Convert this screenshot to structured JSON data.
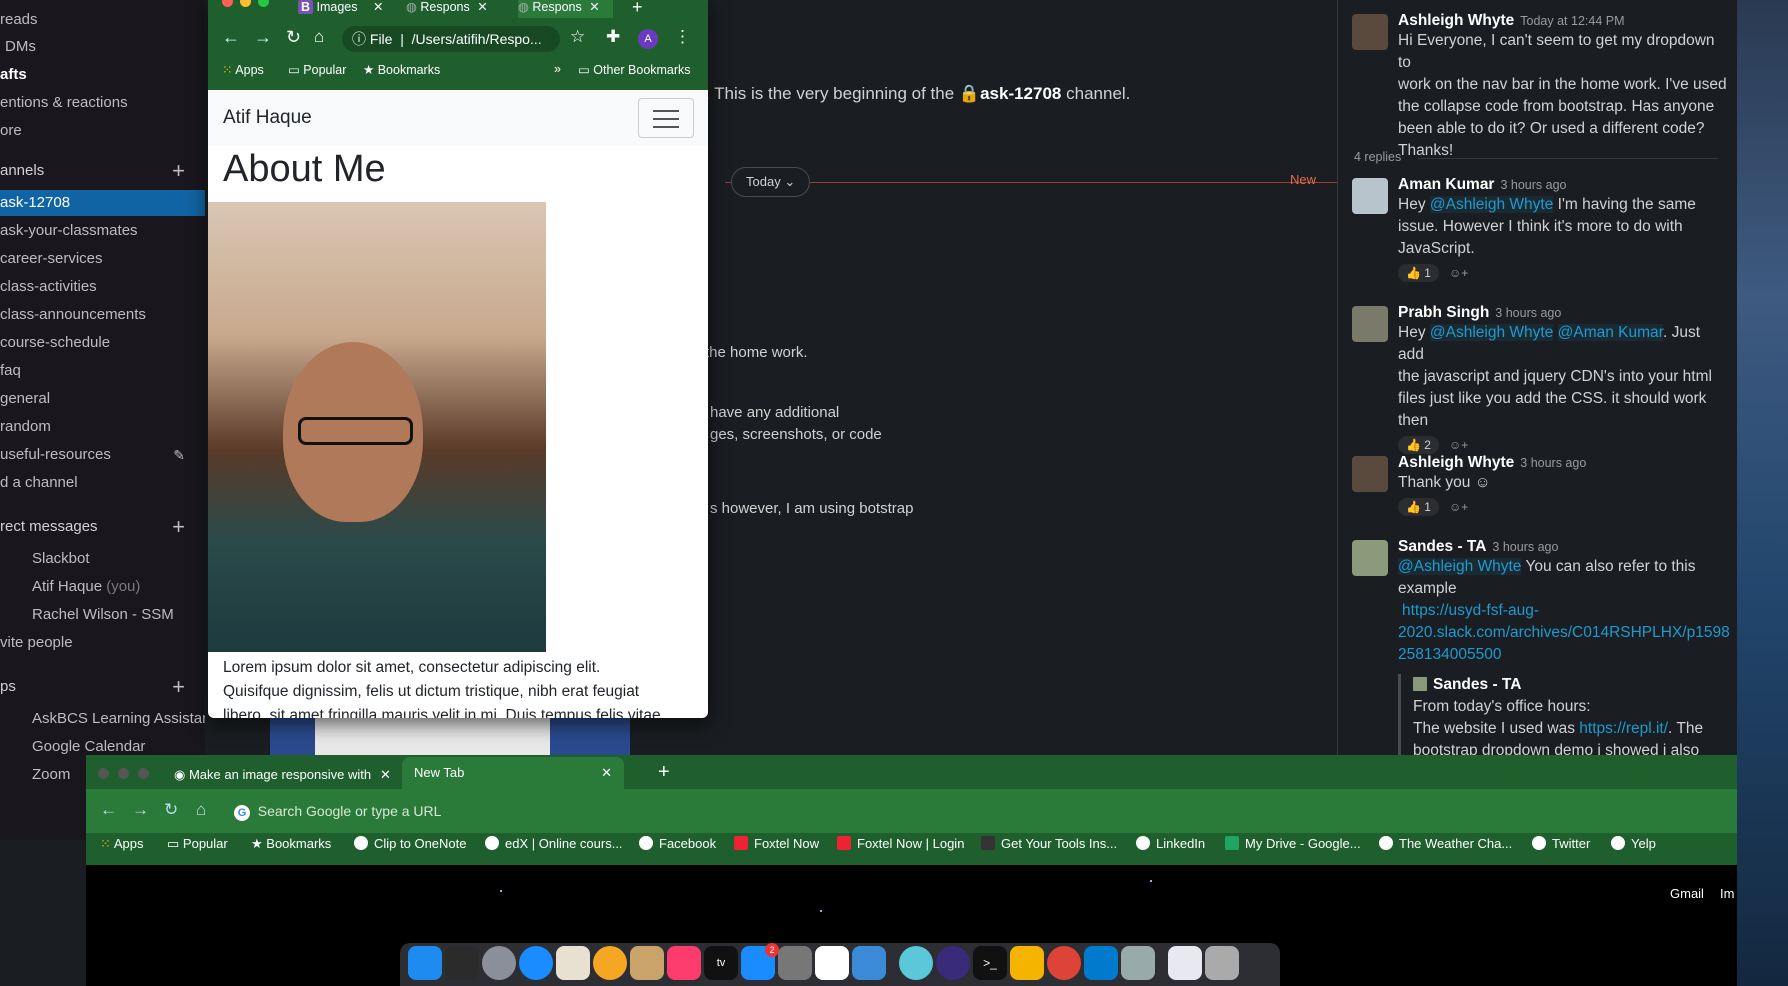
{
  "sidebar": {
    "items": [
      {
        "label": "reads",
        "style": "normal"
      },
      {
        "label": "DMs",
        "style": "normal"
      },
      {
        "label": "afts",
        "style": "bold"
      },
      {
        "label": "entions & reactions",
        "style": "normal"
      },
      {
        "label": "ore",
        "style": "normal"
      }
    ],
    "channels_header": "annels",
    "channels": [
      "ask-12708",
      "ask-your-classmates",
      "career-services",
      "class-activities",
      "class-announcements",
      "course-schedule",
      "faq",
      "general",
      "random",
      "useful-resources"
    ],
    "add_channel": "d a channel",
    "dm_header": "rect messages",
    "dms": [
      "Slackbot",
      "Atif Haque",
      "Rachel Wilson - SSM"
    ],
    "dm_you": "(you)",
    "invite": "vite people",
    "apps_header": "ps",
    "apps": [
      "AskBCS Learning Assistant",
      "Google Calendar",
      "Zoom"
    ]
  },
  "main": {
    "intro_prefix": ". This is the very beginning of the",
    "intro_channel": "ask-12708",
    "intro_suffix": "channel.",
    "today": "Today",
    "new_label": "New",
    "frag1": "the home work.",
    "frag2": "have any additional",
    "frag3": "ges, screenshots, or code",
    "frag4": "s however, I am using botstrap"
  },
  "thread": {
    "op": {
      "name": "Ashleigh Whyte",
      "time": "Today at 12:44 PM",
      "lines": [
        "Hi Everyone, I can't seem to get my dropdown to",
        "work on the nav bar in the home work. I've used",
        "the collapse code from bootstrap. Has anyone",
        "been able to do it? Or used a different code?",
        "Thanks!"
      ]
    },
    "replies_count": "4 replies",
    "r1": {
      "name": "Aman Kumar",
      "time": "3 hours ago",
      "pre": "Hey",
      "mention": "@Ashleigh Whyte",
      "l1": "I'm having the same",
      "l2": "issue. However I think it's more to do with",
      "l3": "JavaScript.",
      "react": "1"
    },
    "r2": {
      "name": "Prabh Singh",
      "time": "3 hours ago",
      "pre": "Hey",
      "m1": "@Ashleigh Whyte",
      "m2": "@Aman Kumar",
      "l1": ". Just add",
      "l2": "the javascript and jquery CDN's into your html",
      "l3": "files just like you add the CSS. it should work",
      "l4": "then",
      "react": "2"
    },
    "r3": {
      "name": "Ashleigh Whyte",
      "time": "3 hours ago",
      "text": "Thank you",
      "react": "1"
    },
    "r4": {
      "name": "Sandes - TA",
      "time": "3 hours ago",
      "mention": "@Ashleigh Whyte",
      "l1": "You can also refer to this",
      "l2": "example",
      "link1": "https://usyd-fsf-aug-",
      "link2": "2020.slack.com/archives/C014RSHPLHX/p1598",
      "link3": "258134005500",
      "quote_name": "Sandes - TA",
      "quote1": "From today's office hours:",
      "quote2a": "The website I used was",
      "quote2link": "https://repl.it/",
      "quote2b": ". The",
      "quote3": "bootstrap dropdown demo i showed i also"
    }
  },
  "chrome1": {
    "tabs": [
      "Images",
      "Respons",
      "Respons"
    ],
    "file_label": "File",
    "url": "/Users/atifih/Respo...",
    "profile": "A",
    "bookmarks": [
      "Apps",
      "Popular",
      "Bookmarks"
    ],
    "other_bookmarks": "Other Bookmarks",
    "more": "»",
    "brand": "Atif Haque",
    "heading": "About Me",
    "lorem1": "Lorem ipsum dolor sit amet, consectetur adipiscing elit.",
    "lorem2": "Quisifque dignissim, felis ut dictum tristique, nibh erat feugiat",
    "lorem3": "libero, sit amet fringilla mauris velit in mi. Duis tempus felis vitae"
  },
  "chrome2": {
    "tab1": "Make an image responsive with",
    "tab2": "New Tab",
    "omnibox_placeholder": "Search Google or type a URL",
    "bookmarks": [
      "Apps",
      "Popular",
      "Bookmarks",
      "Clip to OneNote",
      "edX | Online cours...",
      "Facebook",
      "Foxtel Now",
      "Foxtel Now | Login",
      "Get Your Tools Ins...",
      "LinkedIn",
      "My Drive - Google...",
      "The Weather Cha...",
      "Twitter",
      "Yelp"
    ],
    "gmail": "Gmail",
    "images": "Im"
  },
  "dock": {
    "appstore_badge": "2"
  }
}
